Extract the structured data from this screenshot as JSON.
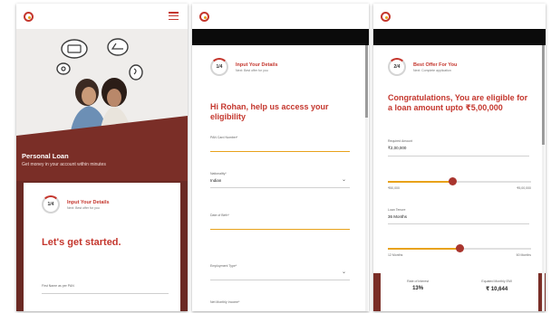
{
  "brand": {
    "tagline": "",
    "name": ""
  },
  "screen1": {
    "banner_title": "Personal Loan",
    "banner_subtitle": "Get money in your account within minutes",
    "step_number": "1/4",
    "step_title": "Input Your Details",
    "step_next": "Next: Best offer for you",
    "heading": "Let's get started.",
    "field_label": "First Name as per PAN"
  },
  "screen2": {
    "step_number": "1/4",
    "step_title": "Input Your Details",
    "step_next": "Next: Best offer for you",
    "headline": "Hi Rohan, help us access your eligibility",
    "fields": {
      "pan_label": "PAN Card Number*",
      "nationality_label": "Nationality*",
      "nationality_value": "Indian",
      "dob_label": "Date of Birth*",
      "employment_label": "Employment Type*",
      "income_label": "Net Monthly Income*"
    }
  },
  "screen3": {
    "step_number": "2/4",
    "step_title": "Best Offer For You",
    "step_next": "Next: Complete application",
    "headline": "Congratulations, You are eligible for a loan amount upto ₹5,00,000",
    "amount_label": "Required Amount",
    "amount_value": "₹2,00,000",
    "amount_min": "₹50,000",
    "amount_max": "₹5,00,000",
    "amount_level": 0.45,
    "tenure_label": "Loan Tenure",
    "tenure_value": "36 Months",
    "tenure_min": "12 Months",
    "tenure_max": "60 Months",
    "tenure_level": 0.5,
    "rate_label": "Rate of Interest",
    "rate_value": "13%",
    "emi_label": "Equated Monthly EMI",
    "emi_value": "₹ 10,644"
  },
  "colors": {
    "brand_red": "#c4362d",
    "maroon": "#7a2e27",
    "accent_yellow": "#e8a21a"
  },
  "icons": {
    "menu": "hamburger-menu-icon",
    "dropdown": "chevron-down-icon"
  }
}
